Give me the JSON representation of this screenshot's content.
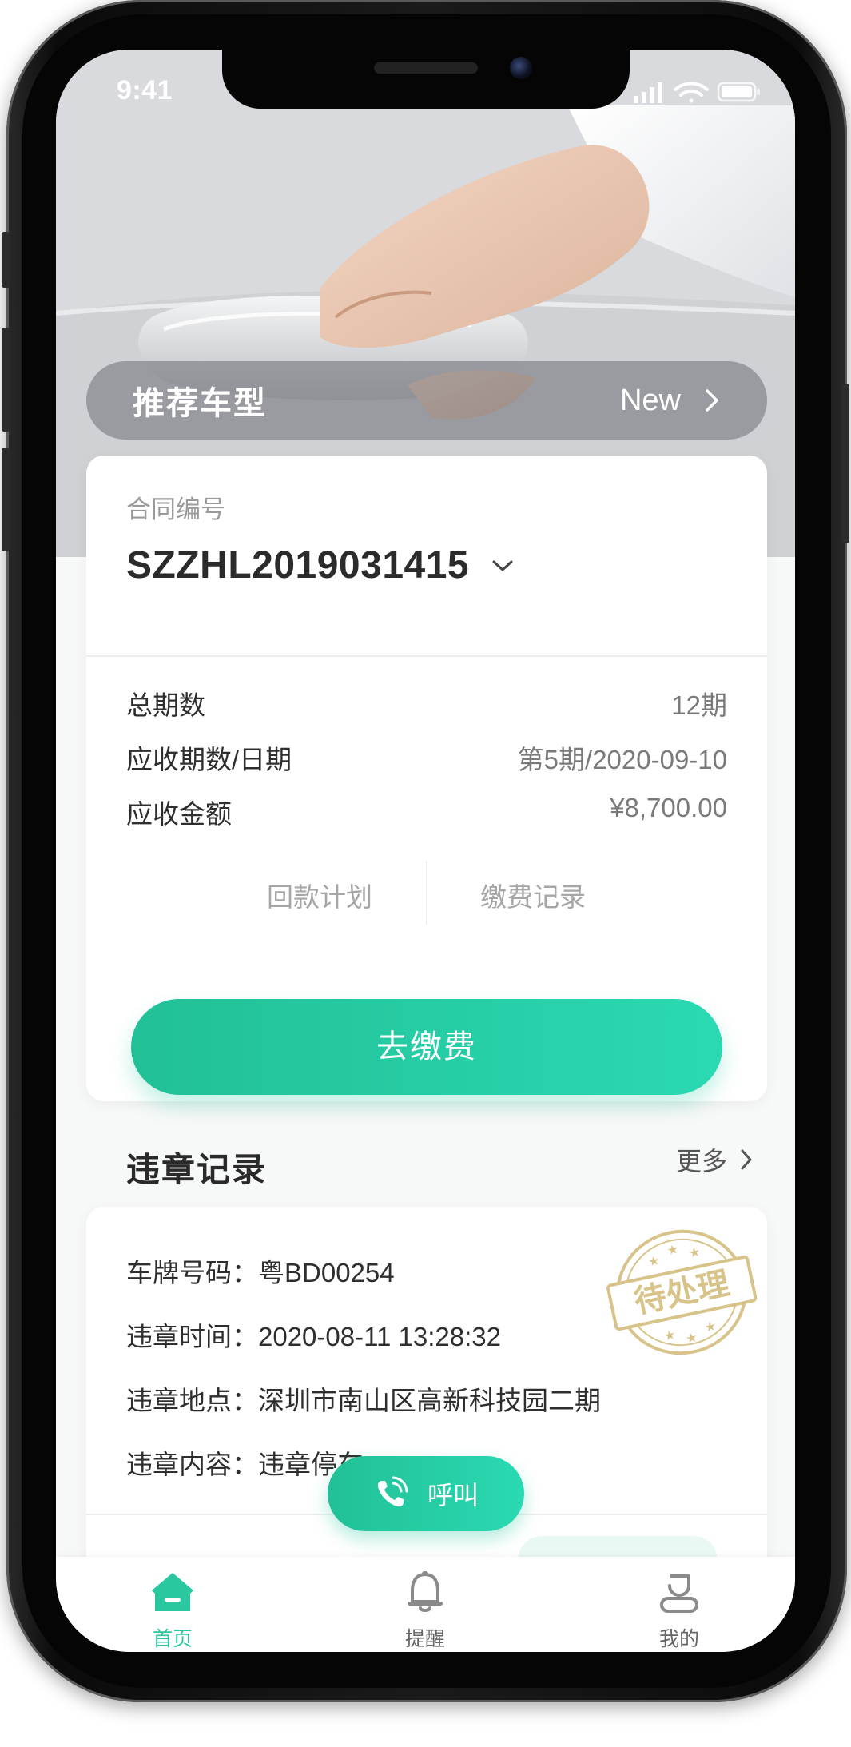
{
  "status_bar": {
    "time": "9:41"
  },
  "banner": {
    "title": "推荐车型",
    "badge": "New"
  },
  "contract": {
    "label": "合同编号",
    "number": "SZZHL2019031415",
    "rows": [
      {
        "label": "总期数",
        "value": "12期"
      },
      {
        "label": "应收期数/日期",
        "value": "第5期/2020-09-10"
      },
      {
        "label": "应收金额",
        "value": "¥8,700.00"
      }
    ],
    "links": {
      "plan": "回款计划",
      "records": "缴费记录"
    },
    "pay_label": "去缴费"
  },
  "violations": {
    "title": "违章记录",
    "more": "更多",
    "lines": [
      "车牌号码：粤BD00254",
      "违章时间：2020-08-11 13:28:32",
      "违章地点：深圳市南山区高新科技园二期",
      "违章内容：违章停车"
    ],
    "stamp_text": "待处理"
  },
  "call_button": {
    "label": "呼叫"
  },
  "tabs": [
    {
      "label": "首页",
      "icon": "home-icon",
      "active": true
    },
    {
      "label": "提醒",
      "icon": "bell-icon",
      "active": false
    },
    {
      "label": "我的",
      "icon": "profile-icon",
      "active": false
    }
  ],
  "colors": {
    "accent": "#2ad0a8",
    "stamp": "#d8c48a"
  }
}
